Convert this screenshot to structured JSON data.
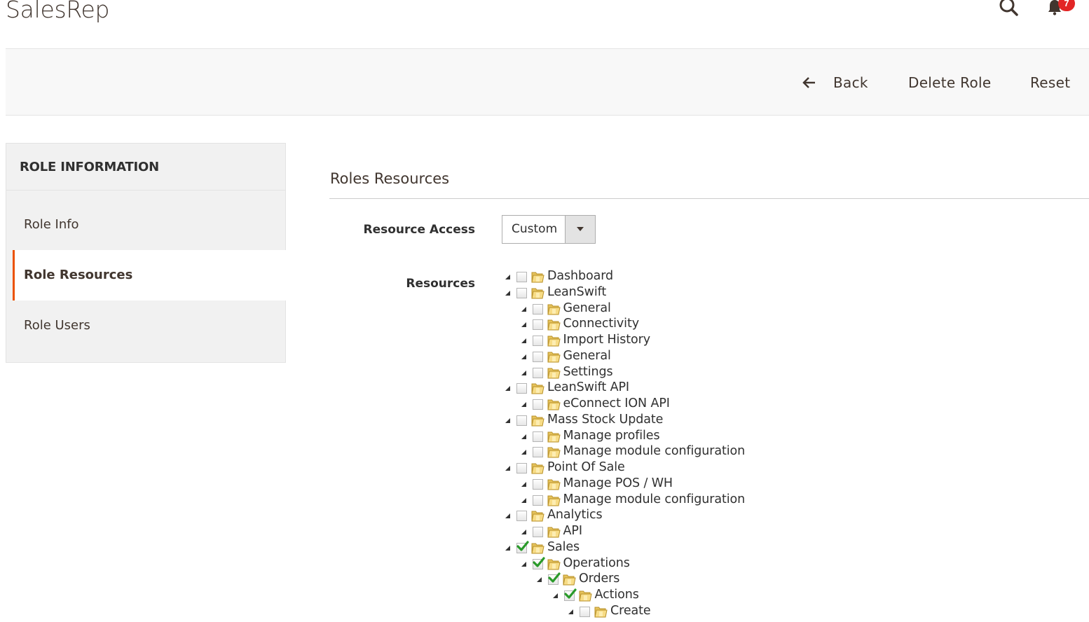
{
  "header": {
    "title": "SalesRep",
    "notification_count": "7"
  },
  "page_actions": {
    "back_label": "Back",
    "delete_label": "Delete Role",
    "reset_label": "Reset"
  },
  "sidebar": {
    "title": "ROLE INFORMATION",
    "items": [
      {
        "label": "Role Info"
      },
      {
        "label": "Role Resources"
      },
      {
        "label": "Role Users"
      }
    ]
  },
  "main": {
    "section_title": "Roles Resources",
    "resource_access_label": "Resource Access",
    "resource_access_value": "Custom",
    "resources_label": "Resources",
    "tree": [
      {
        "label": "Dashboard",
        "level": 0,
        "checked": false
      },
      {
        "label": "LeanSwift",
        "level": 0,
        "checked": false
      },
      {
        "label": "General",
        "level": 1,
        "checked": false
      },
      {
        "label": "Connectivity",
        "level": 1,
        "checked": false
      },
      {
        "label": "Import History",
        "level": 1,
        "checked": false
      },
      {
        "label": "General",
        "level": 1,
        "checked": false
      },
      {
        "label": "Settings",
        "level": 1,
        "checked": false
      },
      {
        "label": "LeanSwift API",
        "level": 0,
        "checked": false
      },
      {
        "label": "eConnect ION API",
        "level": 1,
        "checked": false
      },
      {
        "label": "Mass Stock Update",
        "level": 0,
        "checked": false
      },
      {
        "label": "Manage profiles",
        "level": 1,
        "checked": false
      },
      {
        "label": "Manage module configuration",
        "level": 1,
        "checked": false
      },
      {
        "label": "Point Of Sale",
        "level": 0,
        "checked": false
      },
      {
        "label": "Manage POS / WH",
        "level": 1,
        "checked": false
      },
      {
        "label": "Manage module configuration",
        "level": 1,
        "checked": false
      },
      {
        "label": "Analytics",
        "level": 0,
        "checked": false
      },
      {
        "label": "API",
        "level": 1,
        "checked": false
      },
      {
        "label": "Sales",
        "level": 0,
        "checked": true
      },
      {
        "label": "Operations",
        "level": 1,
        "checked": true
      },
      {
        "label": "Orders",
        "level": 2,
        "checked": true
      },
      {
        "label": "Actions",
        "level": 3,
        "checked": true
      },
      {
        "label": "Create",
        "level": 4,
        "checked": false
      }
    ]
  }
}
